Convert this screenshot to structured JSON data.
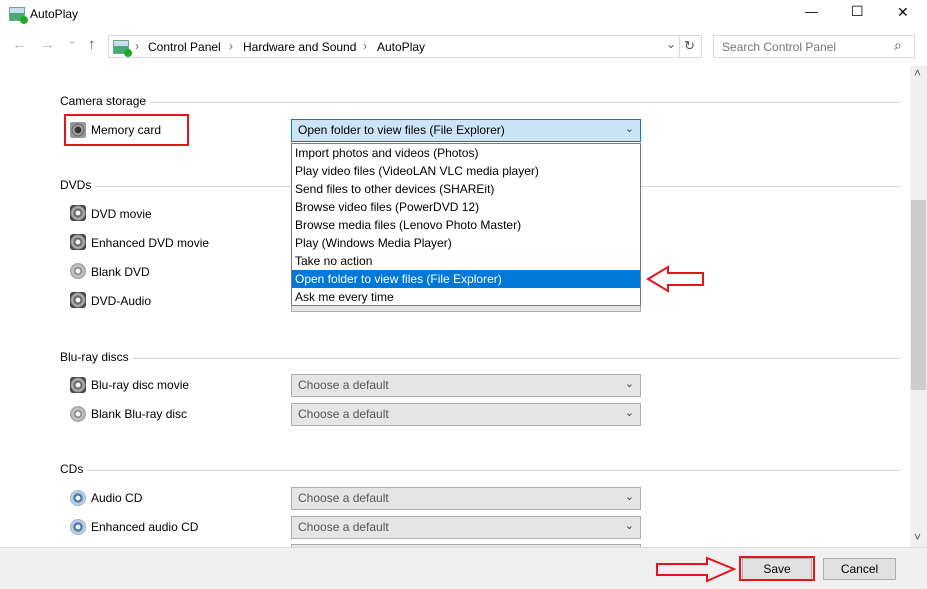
{
  "window": {
    "title": "AutoPlay",
    "minimize": "—",
    "maximize": "☐",
    "close": "✕"
  },
  "nav": {
    "back": "←",
    "forward": "→",
    "recent": "⌄",
    "up": "↑",
    "breadcrumb": [
      "Control Panel",
      "Hardware and Sound",
      "AutoPlay"
    ],
    "separator": "›",
    "history_dropdown": "⌄",
    "refresh": "↻",
    "search_placeholder": "Search Control Panel",
    "search_icon": "⌕"
  },
  "sections": {
    "camera": {
      "title": "Camera storage",
      "rows": [
        {
          "label": "Memory card",
          "value": "Open folder to view files (File Explorer)",
          "icon": "memory-card-icon"
        }
      ]
    },
    "dvds": {
      "title": "DVDs",
      "rows": [
        {
          "label": "DVD movie",
          "icon": "dvd-icon"
        },
        {
          "label": "Enhanced DVD movie",
          "icon": "dvd-icon"
        },
        {
          "label": "Blank DVD",
          "icon": "blank-disc-icon"
        },
        {
          "label": "DVD-Audio",
          "icon": "dvd-icon"
        }
      ]
    },
    "bluray": {
      "title": "Blu-ray discs",
      "rows": [
        {
          "label": "Blu-ray disc movie",
          "value": "Choose a default",
          "icon": "bluray-icon"
        },
        {
          "label": "Blank Blu-ray disc",
          "value": "Choose a default",
          "icon": "blank-disc-icon"
        }
      ]
    },
    "cds": {
      "title": "CDs",
      "rows": [
        {
          "label": "Audio CD",
          "value": "Choose a default",
          "icon": "cd-icon"
        },
        {
          "label": "Enhanced audio CD",
          "value": "Choose a default",
          "icon": "cd-icon"
        }
      ]
    }
  },
  "dropdown_options": [
    "Import photos and videos (Photos)",
    "Play video files (VideoLAN VLC media player)",
    "Send files to other devices (SHAREit)",
    "Browse video files (PowerDVD 12)",
    "Browse media files (Lenovo Photo Master)",
    "Play (Windows Media Player)",
    "Take no action",
    "Open folder to view files (File Explorer)",
    "Ask me every time"
  ],
  "dropdown_selected_index": 7,
  "chevron": "⌄",
  "scrollbar": {
    "up": "˄",
    "down": "˅"
  },
  "footer": {
    "save": "Save",
    "cancel": "Cancel"
  },
  "colors": {
    "annotation_red": "#e8141c",
    "selection_blue": "#0078d7",
    "focused_select_bg": "#cce4f7"
  }
}
